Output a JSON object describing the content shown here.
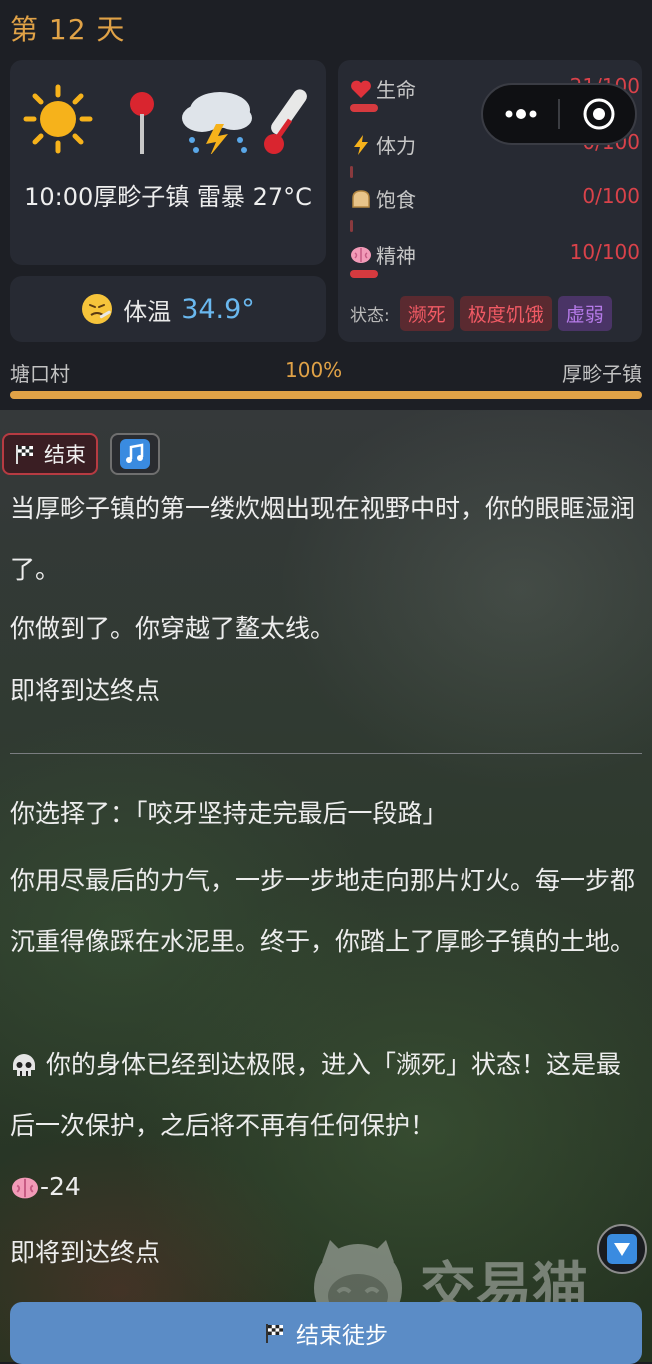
{
  "day": {
    "label": "第 12 天"
  },
  "weather": {
    "icons": [
      "sun-icon",
      "pushpin-icon",
      "thunderstorm-icon",
      "thermometer-icon"
    ],
    "time": "10:00",
    "location": "厚畛子镇",
    "condition": "雷暴",
    "temperature": "27°C"
  },
  "body_temp": {
    "icon": "sick-face-icon",
    "label": "体温",
    "value": "34.9°"
  },
  "stats": [
    {
      "icon": "heart-icon",
      "label": "生命",
      "value": "21/100",
      "level": 0.21
    },
    {
      "icon": "lightning-icon",
      "label": "体力",
      "value": "0/100",
      "level": 0
    },
    {
      "icon": "bread-icon",
      "label": "饱食",
      "value": "0/100",
      "level": 0
    },
    {
      "icon": "brain-icon",
      "label": "精神",
      "value": "10/100",
      "level": 0.1
    }
  ],
  "status": {
    "label": "状态:",
    "badges": [
      {
        "text": "濒死",
        "color": "#f05a64"
      },
      {
        "text": "极度饥饿",
        "color": "#f05a64"
      },
      {
        "text": "虚弱",
        "color": "#b57ae8"
      }
    ]
  },
  "route": {
    "from": "塘口村",
    "to": "厚畛子镇",
    "progress_text": "100%",
    "progress": 1.0
  },
  "story": {
    "end_tag": "结束",
    "music_icon": "music-note-icon",
    "paragraphs_1": [
      "当厚畛子镇的第一缕炊烟出现在视野中时，你的眼眶湿润了。",
      "你做到了。你穿越了鳌太线。",
      "即将到达终点"
    ],
    "choice": "你选择了：「咬牙坚持走完最后一段路」",
    "result": "你用尽最后的力气，一步一步地走向那片灯火。每一步都沉重得像踩在水泥里。终于，你踏上了厚畛子镇的土地。",
    "warning": "你的身体已经到达极限，进入「濒死」状态！这是最后一次保护，之后将不再有任何保护！",
    "effect": "-24",
    "arriving": "即将到达终点"
  },
  "watermark": {
    "text": "交易猫"
  },
  "end_button": {
    "label": "结束徒步"
  },
  "colors": {
    "accent": "#e0a247",
    "danger": "#d63a3f",
    "button": "#5b8cc6",
    "temp_value": "#6ab8ef"
  }
}
